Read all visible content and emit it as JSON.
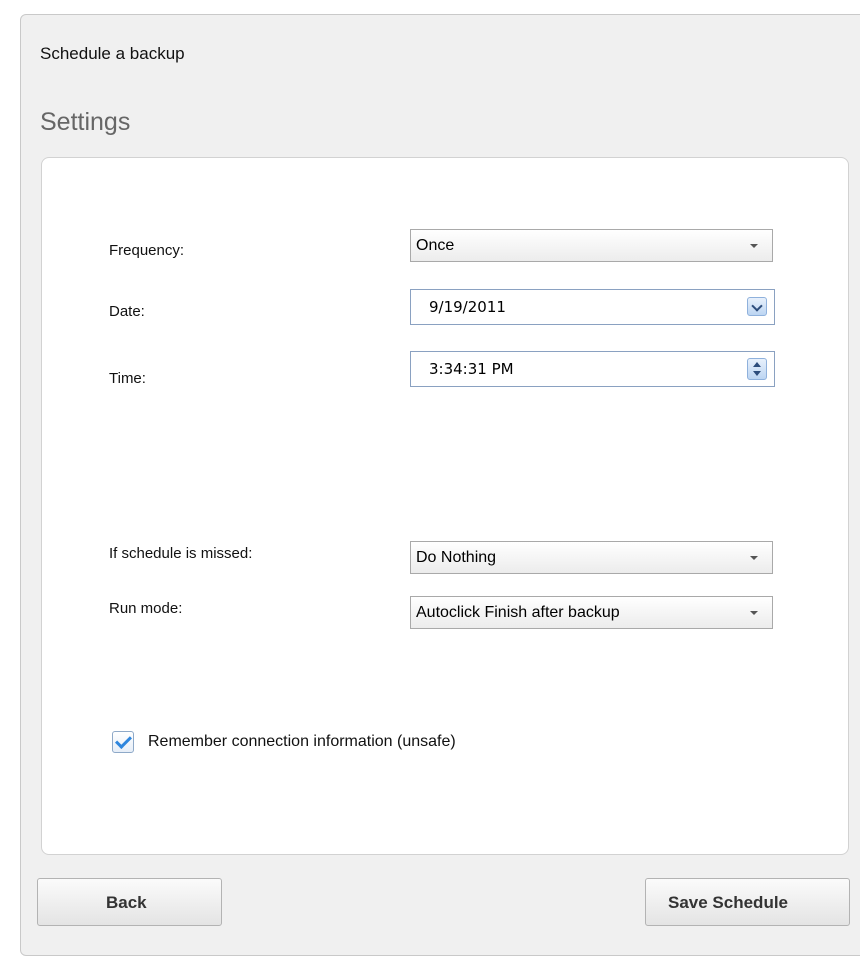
{
  "dialog": {
    "title": "Schedule a backup",
    "section": "Settings"
  },
  "form": {
    "frequency": {
      "label": "Frequency:",
      "value": "Once"
    },
    "date": {
      "label": "Date:",
      "value": "9/19/2011"
    },
    "time": {
      "label": "Time:",
      "value": "3:34:31 PM"
    },
    "missed": {
      "label": "If schedule is missed:",
      "value": "Do Nothing"
    },
    "run_mode": {
      "label": "Run mode:",
      "value": "Autoclick Finish after backup"
    },
    "remember": {
      "label": "Remember connection information (unsafe)",
      "checked": true
    }
  },
  "buttons": {
    "back": "Back",
    "save": "Save Schedule"
  },
  "colors": {
    "accent": "#2e86de",
    "panel_border": "#d2d2d2",
    "window_bg": "#f0f0f0"
  },
  "icons": {
    "dropdown": "chevron-down-icon",
    "date_picker": "calendar-dropdown-icon",
    "spinner": "spinner-arrows-icon",
    "check": "checkmark-icon"
  }
}
